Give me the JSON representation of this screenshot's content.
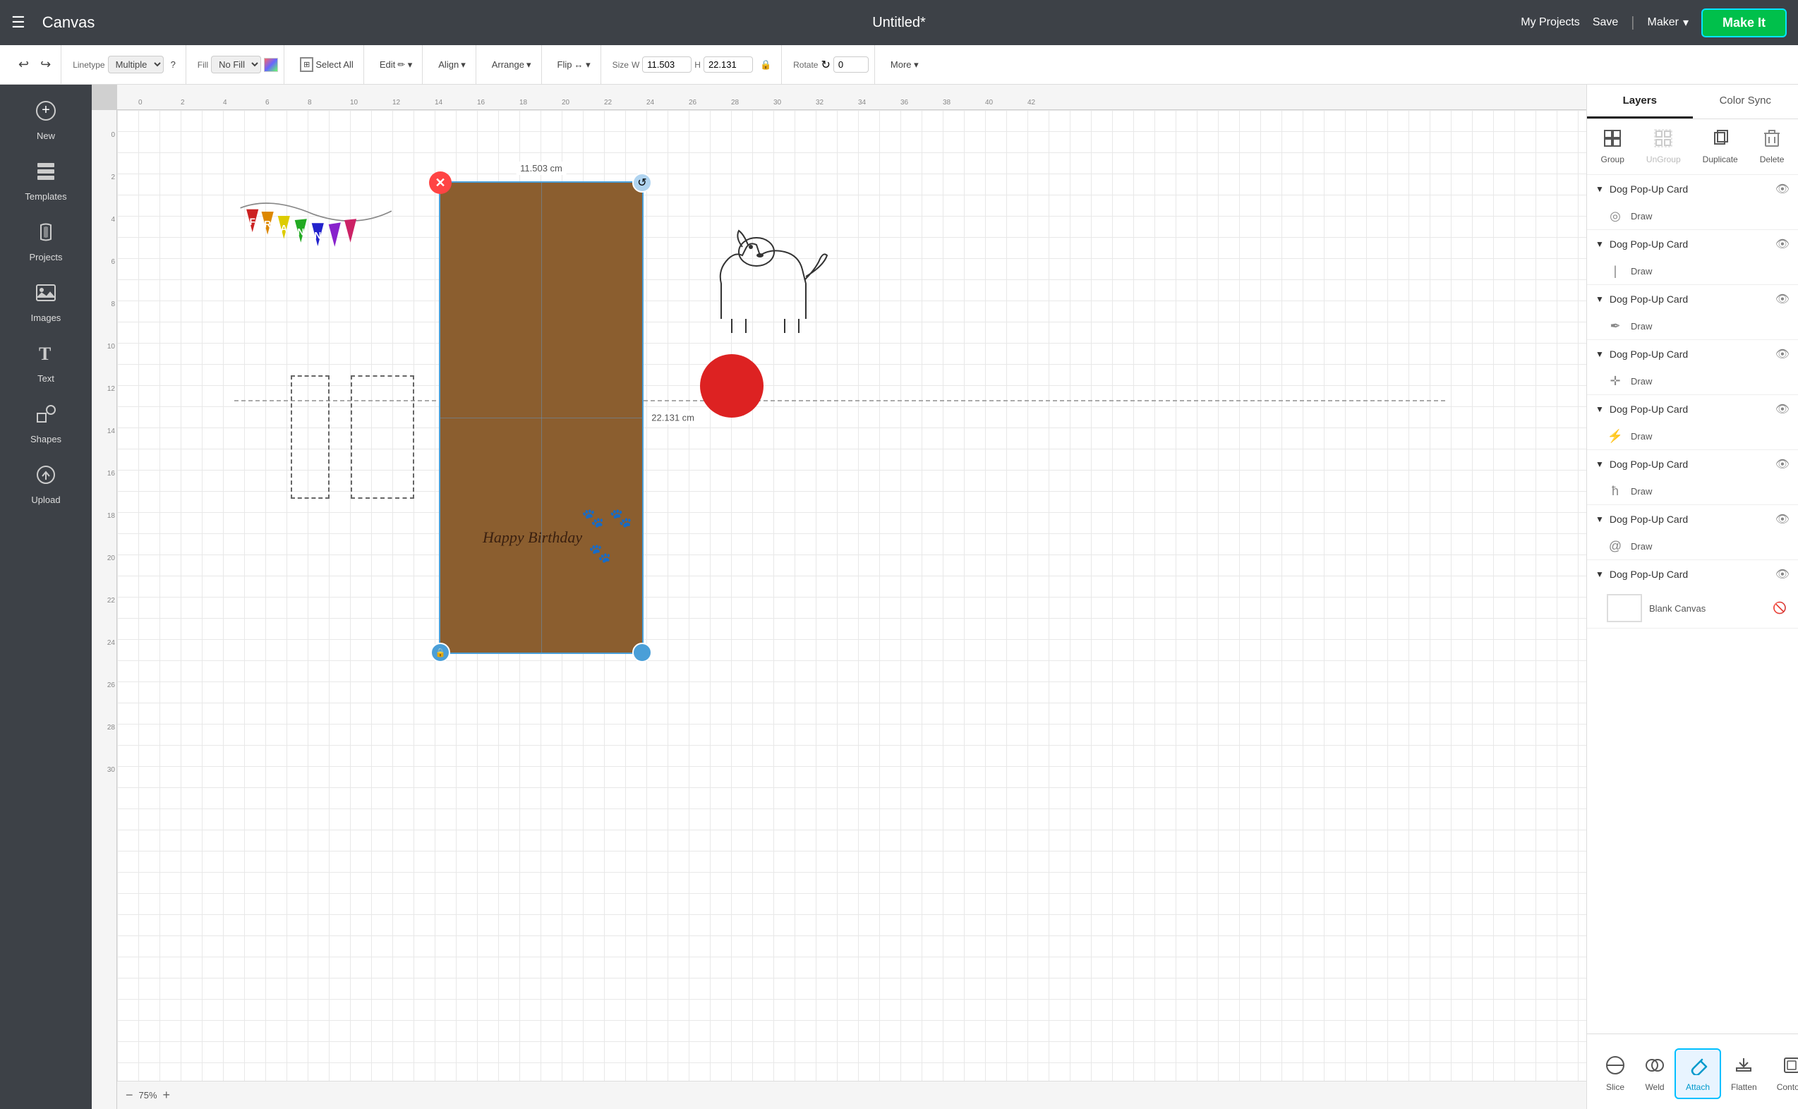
{
  "topbar": {
    "menu_label": "☰",
    "logo": "Canvas",
    "title": "Untitled*",
    "my_projects": "My Projects",
    "save": "Save",
    "divider": "|",
    "maker": "Maker",
    "maker_arrow": "▾",
    "make_it": "Make It"
  },
  "toolbar": {
    "undo_icon": "↩",
    "redo_icon": "↪",
    "linetype_label": "Linetype",
    "linetype_value": "Multiple",
    "linetype_help": "?",
    "fill_label": "Fill",
    "fill_value": "No Fill",
    "select_all": "Select All",
    "edit": "Edit",
    "align": "Align",
    "arrange": "Arrange",
    "flip": "Flip",
    "size_label": "Size",
    "width_label": "W",
    "width_value": "11.503",
    "height_label": "H",
    "height_value": "22.131",
    "lock_icon": "🔒",
    "rotate_label": "Rotate",
    "rotate_value": "0",
    "more": "More ▾"
  },
  "sidebar": {
    "items": [
      {
        "id": "new",
        "icon": "＋",
        "label": "New"
      },
      {
        "id": "templates",
        "icon": "☰",
        "label": "Templates"
      },
      {
        "id": "projects",
        "icon": "👕",
        "label": "Projects"
      },
      {
        "id": "images",
        "icon": "🖼",
        "label": "Images"
      },
      {
        "id": "text",
        "icon": "T",
        "label": "Text"
      },
      {
        "id": "shapes",
        "icon": "✦",
        "label": "Shapes"
      },
      {
        "id": "upload",
        "icon": "⬆",
        "label": "Upload"
      }
    ]
  },
  "canvas": {
    "zoom": "75%",
    "width_label": "11.503 cm",
    "height_label": "22.131 cm",
    "birthday_text": "Happy Birthday",
    "paw_prints": "🐾 🐾\n🐾"
  },
  "right_panel": {
    "tabs": [
      {
        "id": "layers",
        "label": "Layers",
        "active": true
      },
      {
        "id": "color_sync",
        "label": "Color Sync",
        "active": false
      }
    ],
    "actions": [
      {
        "id": "group",
        "icon": "⊞",
        "label": "Group"
      },
      {
        "id": "ungroup",
        "icon": "⊟",
        "label": "UnGroup",
        "disabled": true
      },
      {
        "id": "duplicate",
        "icon": "❐",
        "label": "Duplicate"
      },
      {
        "id": "delete",
        "icon": "🗑",
        "label": "Delete"
      }
    ],
    "layers": [
      {
        "id": "layer1",
        "title": "Dog Pop-Up Card",
        "visible": true,
        "items": [
          {
            "icon": "◉",
            "label": "Draw"
          }
        ]
      },
      {
        "id": "layer2",
        "title": "Dog Pop-Up Card",
        "visible": true,
        "items": [
          {
            "icon": "│",
            "label": "Draw"
          }
        ]
      },
      {
        "id": "layer3",
        "title": "Dog Pop-Up Card",
        "visible": true,
        "items": [
          {
            "icon": "🖊",
            "label": "Draw"
          }
        ]
      },
      {
        "id": "layer4",
        "title": "Dog Pop-Up Card",
        "visible": true,
        "items": [
          {
            "icon": "✛",
            "label": "Draw"
          }
        ]
      },
      {
        "id": "layer5",
        "title": "Dog Pop-Up Card",
        "visible": true,
        "items": [
          {
            "icon": "⚡",
            "label": "Draw"
          }
        ]
      },
      {
        "id": "layer6",
        "title": "Dog Pop-Up Card",
        "visible": true,
        "items": [
          {
            "icon": "🖊",
            "label": "Draw"
          }
        ]
      },
      {
        "id": "layer7",
        "title": "Dog Pop-Up Card",
        "visible": true,
        "items": [
          {
            "icon": "@",
            "label": "Draw"
          }
        ]
      },
      {
        "id": "layer8",
        "title": "Dog Pop-Up Card",
        "visible": true,
        "items": [
          {
            "icon": "□",
            "label": "Blank Canvas"
          }
        ]
      }
    ],
    "bottom_actions": [
      {
        "id": "slice",
        "icon": "✂",
        "label": "Slice",
        "active": false
      },
      {
        "id": "weld",
        "icon": "⊕",
        "label": "Weld",
        "active": false
      },
      {
        "id": "attach",
        "icon": "📎",
        "label": "Attach",
        "active": true
      },
      {
        "id": "flatten",
        "icon": "⬇",
        "label": "Flatten",
        "active": false
      },
      {
        "id": "contour",
        "icon": "◻",
        "label": "Contour",
        "active": false
      }
    ]
  }
}
